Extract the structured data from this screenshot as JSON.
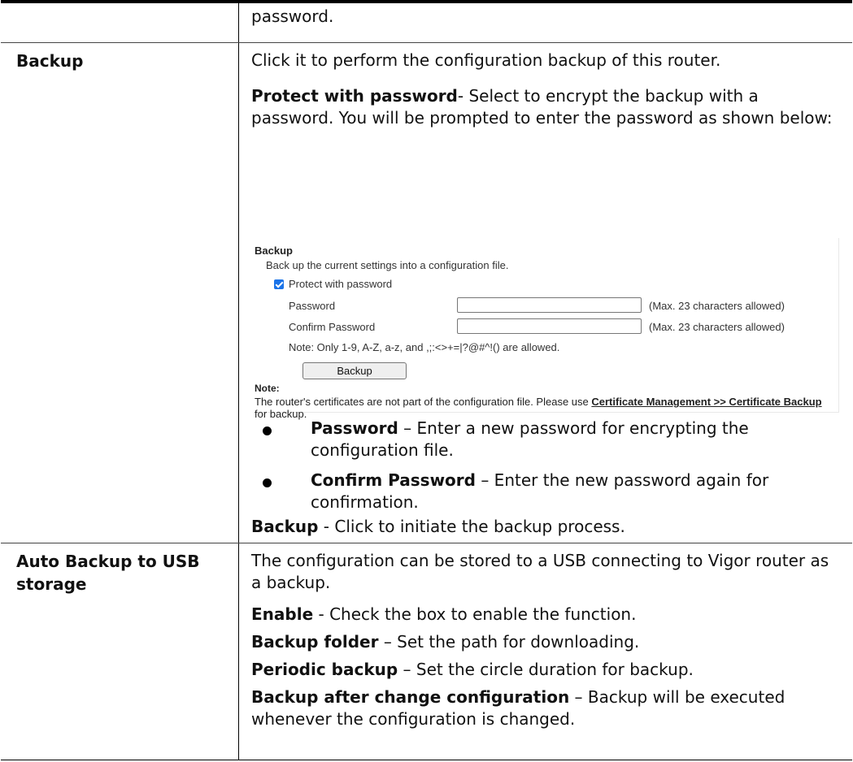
{
  "row_top": {
    "description_tail": "password."
  },
  "backup_row": {
    "term": "Backup",
    "intro": "Click it to perform the configuration backup of this router.",
    "protect_label": "Protect with password",
    "protect_text": "- Select to encrypt the backup with a password. You will be prompted to enter the password as shown below:",
    "screenshot": {
      "heading": "Backup",
      "description": "Back up the current settings into a configuration file.",
      "checkbox_label": "Protect with password",
      "checkbox_checked": true,
      "password_label": "Password",
      "password_hint": "(Max. 23 characters allowed)",
      "confirm_label": "Confirm Password",
      "confirm_hint": "(Max. 23 characters allowed)",
      "note_chars": "Note: Only 1-9, A-Z, a-z, and ,;:<>+=|?@#^!() are allowed.",
      "button_label": "Backup",
      "note_title": "Note:",
      "note_text_1": "The router's certificates are not part of the configuration file. Please use ",
      "note_link": "Certificate Management >> Certificate Backup",
      "note_text_2": " for backup."
    },
    "bullets": [
      {
        "label": "Password",
        "text": " – Enter a new password for encrypting the configuration file."
      },
      {
        "label": "Confirm Password",
        "text": " – Enter the new password again for confirmation."
      }
    ],
    "backup_label": "Backup",
    "backup_text": " - Click to initiate the backup process."
  },
  "usb_row": {
    "term": "Auto Backup to USB storage",
    "intro": "The configuration can be stored to a USB connecting to Vigor router as a backup.",
    "items": [
      {
        "label": "Enable",
        "text": " - Check the box to enable the function."
      },
      {
        "label": "Backup folder",
        "text": " – Set the path for downloading."
      },
      {
        "label": "Periodic backup",
        "text": " – Set the circle duration for backup."
      },
      {
        "label": "Backup after change configuration",
        "text": " – Backup will be executed whenever the configuration is changed."
      }
    ]
  }
}
